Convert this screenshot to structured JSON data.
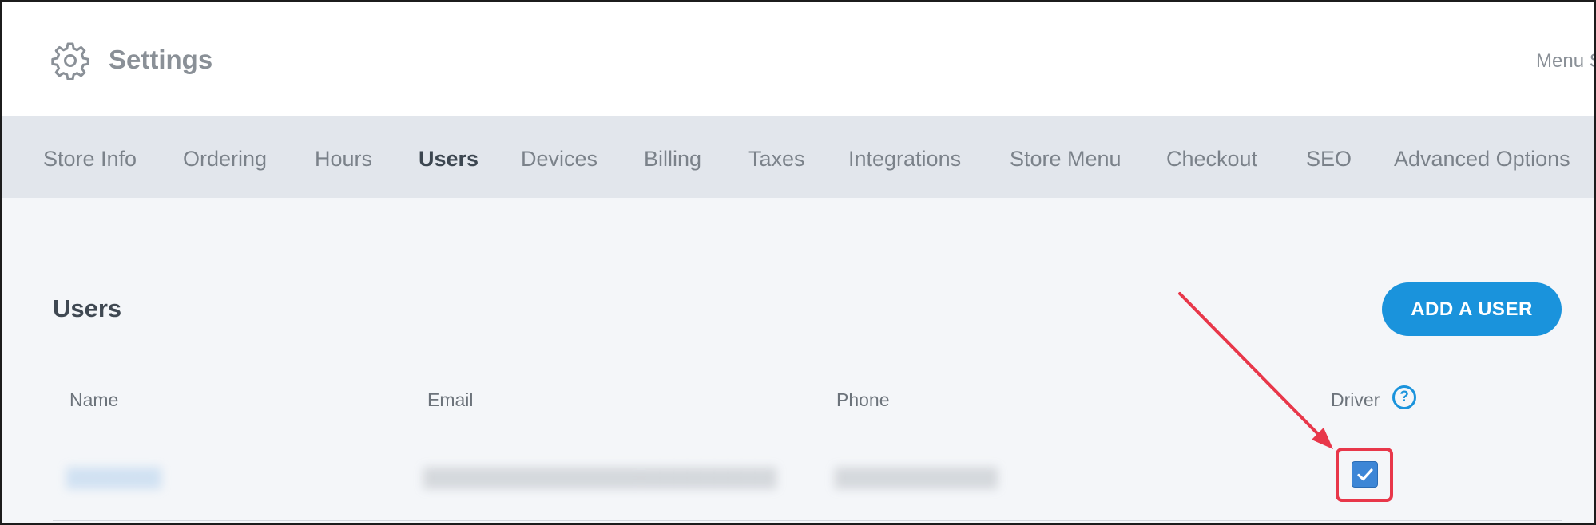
{
  "header": {
    "title": "Settings",
    "menu_link": "Menu S"
  },
  "tabs": [
    {
      "label": "Store Info",
      "active": false
    },
    {
      "label": "Ordering",
      "active": false
    },
    {
      "label": "Hours",
      "active": false
    },
    {
      "label": "Users",
      "active": true
    },
    {
      "label": "Devices",
      "active": false
    },
    {
      "label": "Billing",
      "active": false
    },
    {
      "label": "Taxes",
      "active": false
    },
    {
      "label": "Integrations",
      "active": false
    },
    {
      "label": "Store Menu",
      "active": false
    },
    {
      "label": "Checkout",
      "active": false
    },
    {
      "label": "SEO",
      "active": false
    },
    {
      "label": "Advanced Options",
      "active": false
    }
  ],
  "users_section": {
    "title": "Users",
    "add_button_label": "ADD A USER",
    "columns": [
      "Name",
      "Email",
      "Phone",
      "Driver"
    ],
    "help_glyph": "?",
    "rows": [
      {
        "name": "▒▒▒▒▒▒▒",
        "email": "▒▒▒▒▒▒▒▒▒▒▒▒▒▒▒▒▒▒▒▒▒▒▒▒▒▒",
        "phone": "▒▒▒▒▒▒▒▒▒▒▒▒",
        "driver": true
      }
    ]
  },
  "annotation": {
    "color": "#e8374a"
  },
  "colors": {
    "accent": "#1a93dc",
    "checkbox": "#3d86d6",
    "tab_bar": "#e2e6ec",
    "page_bg": "#f4f6f9"
  },
  "icons": {
    "settings": "gear-icon",
    "help": "question-circle-icon",
    "checkbox": "checkmark-icon"
  }
}
